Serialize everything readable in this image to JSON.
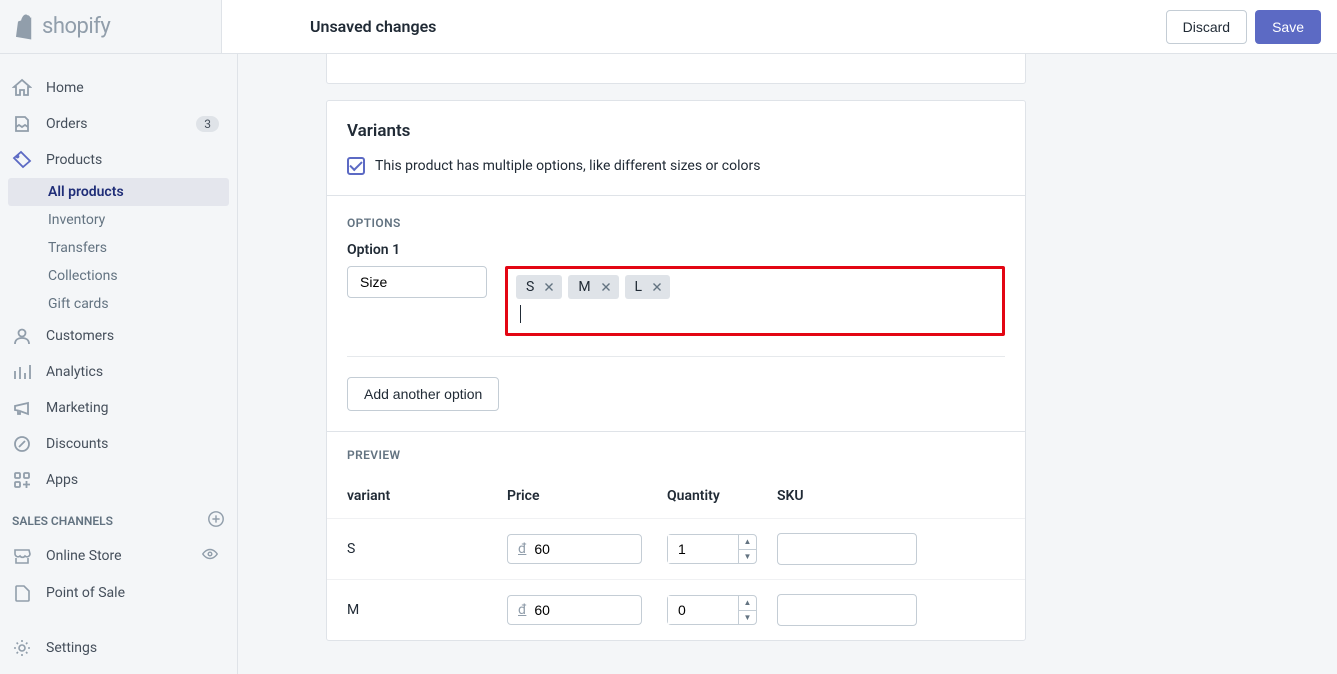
{
  "topbar": {
    "brand": "shopify",
    "title": "Unsaved changes",
    "discard": "Discard",
    "save": "Save"
  },
  "sidebar": {
    "home": "Home",
    "orders": "Orders",
    "orders_badge": "3",
    "products": "Products",
    "all_products": "All products",
    "inventory": "Inventory",
    "transfers": "Transfers",
    "collections": "Collections",
    "gift_cards": "Gift cards",
    "customers": "Customers",
    "analytics": "Analytics",
    "marketing": "Marketing",
    "discounts": "Discounts",
    "apps": "Apps",
    "sales_channels": "SALES CHANNELS",
    "online_store": "Online Store",
    "point_of_sale": "Point of Sale",
    "settings": "Settings"
  },
  "variants": {
    "title": "Variants",
    "checkbox_label": "This product has multiple options, like different sizes or colors",
    "options_header": "OPTIONS",
    "option1_label": "Option 1",
    "option1_name": "Size",
    "option1_values": [
      "S",
      "M",
      "L"
    ],
    "add_option": "Add another option",
    "preview_header": "PREVIEW",
    "columns": {
      "variant": "variant",
      "price": "Price",
      "quantity": "Quantity",
      "sku": "SKU"
    },
    "currency_prefix": "đ",
    "rows": [
      {
        "variant": "S",
        "price": "60",
        "qty": "1",
        "sku": ""
      },
      {
        "variant": "M",
        "price": "60",
        "qty": "0",
        "sku": ""
      }
    ]
  }
}
